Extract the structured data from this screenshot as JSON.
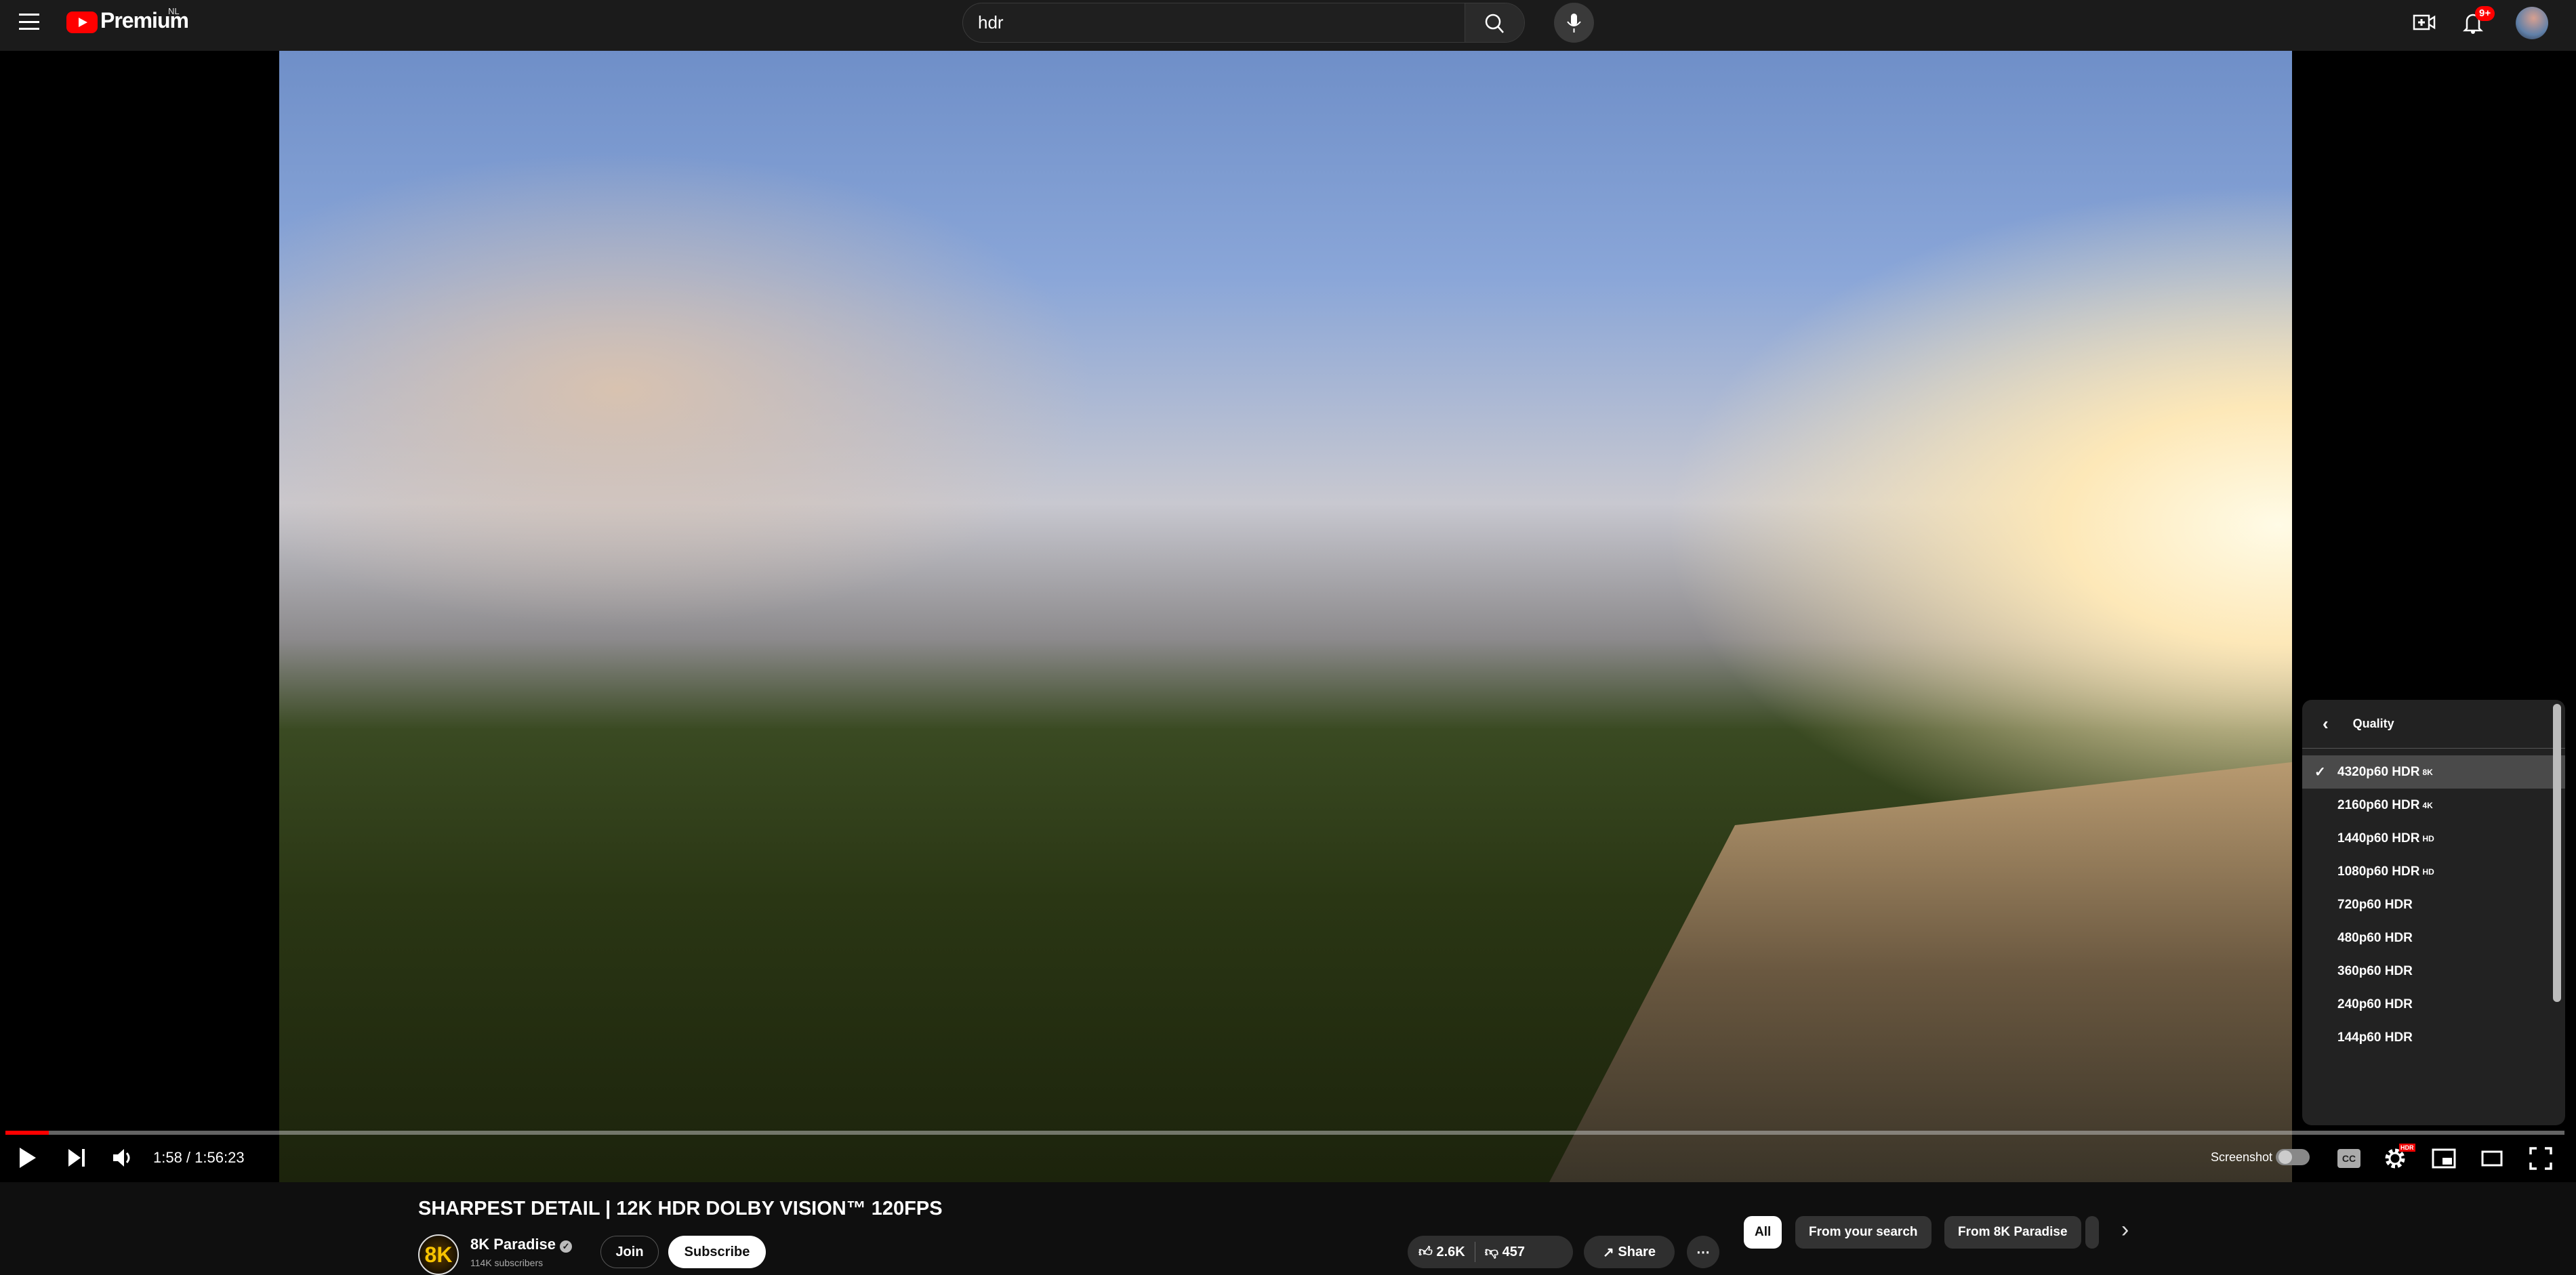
{
  "header": {
    "logo_text": "Premium",
    "region": "NL",
    "search_value": "hdr",
    "notification_count": "9+"
  },
  "player": {
    "time": "1:58 / 1:56:23",
    "progress_fraction": 0.017,
    "screenshot_label": "Screenshot",
    "settings_badge": "HDR",
    "quality_menu": {
      "title": "Quality",
      "items": [
        {
          "label": "4320p60 HDR",
          "badge": "8K",
          "selected": true
        },
        {
          "label": "2160p60 HDR",
          "badge": "4K"
        },
        {
          "label": "1440p60 HDR",
          "badge": "HD"
        },
        {
          "label": "1080p60 HDR",
          "badge": "HD"
        },
        {
          "label": "720p60 HDR",
          "badge": ""
        },
        {
          "label": "480p60 HDR",
          "badge": ""
        },
        {
          "label": "360p60 HDR",
          "badge": ""
        },
        {
          "label": "240p60 HDR",
          "badge": ""
        },
        {
          "label": "144p60 HDR",
          "badge": ""
        }
      ]
    }
  },
  "video": {
    "title": "SHARPEST DETAIL | 12K HDR DOLBY VISION™ 120FPS",
    "channel": "8K Paradise",
    "channel_avatar_text": "8K",
    "subscribers": "114K subscribers",
    "join": "Join",
    "subscribe": "Subscribe",
    "likes": "2.6K",
    "dislikes": "457",
    "share": "Share",
    "more": "⋯"
  },
  "chips": [
    "All",
    "From your search",
    "From 8K Paradise"
  ],
  "colors": {
    "accent": "#ff0000",
    "header_bg": "#1b1b1b",
    "page_bg": "#0f0f0f"
  }
}
